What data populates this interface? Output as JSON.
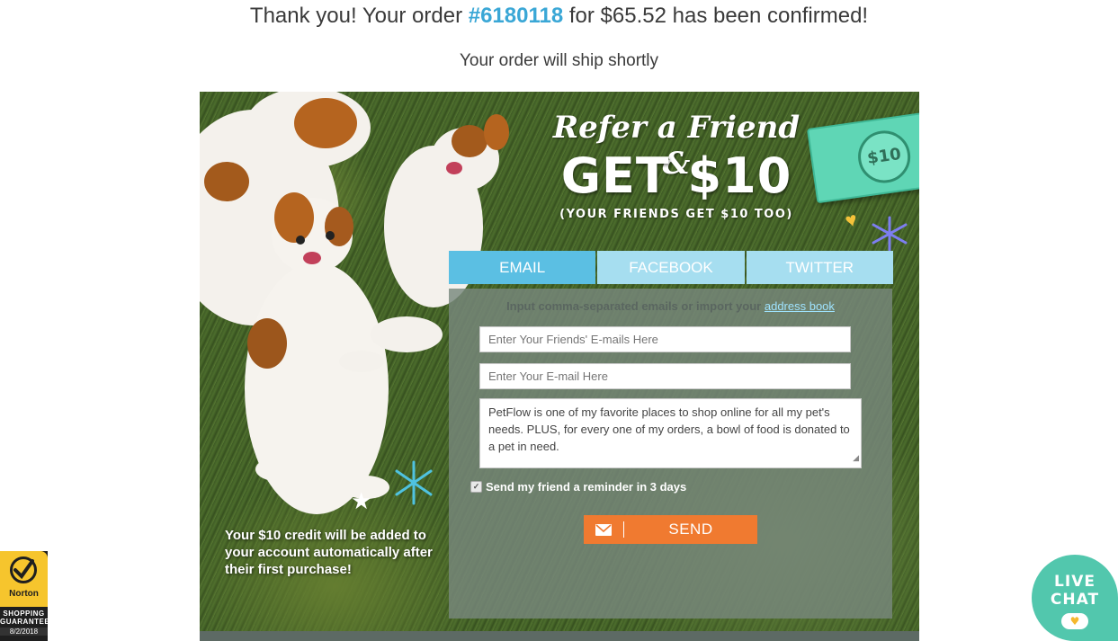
{
  "confirmation": {
    "prefix": "Thank you! Your order ",
    "order_number": "#6180118",
    "suffix": " for $65.52 has been confirmed!",
    "subtitle": "Your order will ship shortly"
  },
  "promo": {
    "title_script": "Refer a Friend &",
    "title_big": "GET $10",
    "title_small": "(YOUR FRIENDS GET $10 TOO)",
    "bill_value": "$10",
    "credit_text": "Your $10 credit will be added to your account automatically after their first purchase!"
  },
  "tabs": [
    {
      "label": "EMAIL",
      "active": true
    },
    {
      "label": "FACEBOOK",
      "active": false
    },
    {
      "label": "TWITTER",
      "active": false
    }
  ],
  "form": {
    "import_text": "Input comma-separated emails or import your ",
    "import_link": "address book",
    "friends_placeholder": "Enter Your Friends' E-mails Here",
    "email_placeholder": "Enter Your E-mail Here",
    "message": "PetFlow is one of my favorite places to shop online for all my pet's needs. PLUS, for every one of my orders, a bowl of food is donated to a pet in need.",
    "reminder_label": "Send my friend a reminder in 3 days",
    "reminder_checked": true,
    "send_label": "SEND"
  },
  "norton": {
    "brand": "Norton",
    "guarantee": "SHOPPING GUARANTEE",
    "date": "8/2/2018"
  },
  "live_chat": {
    "label_line1": "LIVE",
    "label_line2": "CHAT"
  },
  "colors": {
    "accent_blue": "#5bbfe3",
    "send_orange": "#f07a30",
    "chat_green": "#52c7ad",
    "norton_yellow": "#f6c52d"
  }
}
